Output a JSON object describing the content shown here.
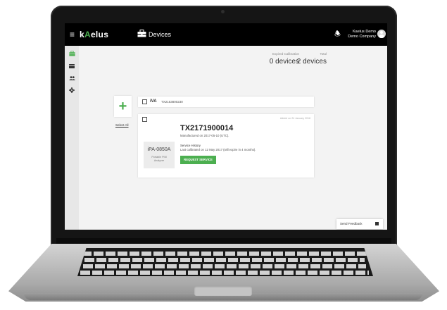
{
  "topbar": {
    "menu_icon": "menu-icon",
    "logo_prefix": "k",
    "logo_accent": "A",
    "logo_suffix": "elus",
    "page_icon": "toolbox-icon",
    "page_title": "Devices",
    "bell_icon": "bell-icon",
    "user_line1": "Kaelus Demo",
    "user_line2": "Demo Company"
  },
  "sidebar": {
    "items": [
      {
        "icon": "toolbox-icon",
        "active": true
      },
      {
        "icon": "card-icon",
        "active": false
      },
      {
        "icon": "users-icon",
        "active": false
      },
      {
        "icon": "gear-icon",
        "active": false
      }
    ]
  },
  "stats": {
    "expired_label": "Expired Calibration",
    "expired_value": "0 devices",
    "total_label": "Total",
    "total_value": "2 devices"
  },
  "actions": {
    "add_symbol": "+",
    "select_all": "Select All"
  },
  "iva_row": {
    "name": "iVA",
    "serial": "TX2153800230"
  },
  "device": {
    "added_on": "Added on 24 January 2018",
    "serial": "TX2171900014",
    "manufactured": "Manufactured on 2017-05-10 (UTC).",
    "service_title": "Service History",
    "service_detail": "Last calibrated on 12 May 2017 (will expire in 4 months).",
    "request_button": "REQUEST SERVICE",
    "model_name": "iPA-0850A",
    "model_desc": "Portable PIM Analyzer"
  },
  "feedback": {
    "label": "Send Feedback",
    "icon": "flag-icon"
  },
  "colors": {
    "accent": "#4caf50",
    "topbar": "#000000",
    "background": "#f3f3f3"
  }
}
